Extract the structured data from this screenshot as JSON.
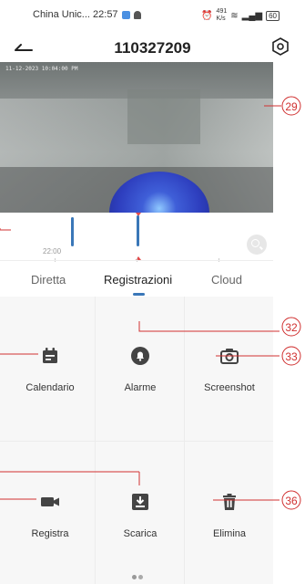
{
  "status_bar": {
    "carrier_time": "China Unic... 22:57",
    "speed_top": "491",
    "speed_unit": "K/s",
    "battery": "60"
  },
  "header": {
    "title": "110327209"
  },
  "video": {
    "timestamp": "11-12-2023 10:04:00 PM"
  },
  "timeline": {
    "time_label": "22:00"
  },
  "tabs": {
    "live": "Diretta",
    "recordings": "Registrazioni",
    "cloud": "Cloud"
  },
  "actions": {
    "calendar": "Calendario",
    "alarm": "Alarme",
    "screenshot": "Screenshot",
    "record": "Registra",
    "download": "Scarica",
    "delete": "Elimina"
  },
  "annotations": {
    "n29": "29",
    "n32": "32",
    "n33": "33",
    "n36": "36"
  },
  "colors": {
    "accent": "#3a77b8",
    "icon": "#444444",
    "playhead": "#e34b4b",
    "annotation": "#d03030"
  }
}
